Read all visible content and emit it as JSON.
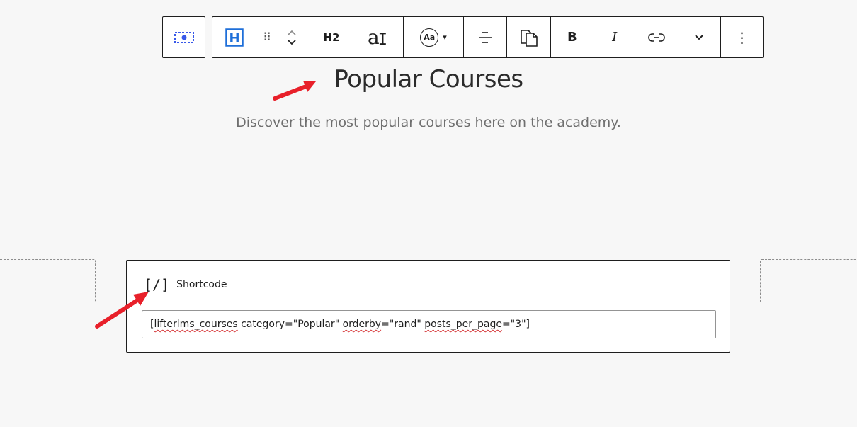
{
  "toolbar": {
    "parent_block_label": "Select parent block",
    "block_type_icon": "H",
    "drag_handle": "⠿",
    "heading_level": "H2",
    "font_size_icon": "a",
    "text_style_label": "Aa",
    "text_style_caret": "▾",
    "bold": "B",
    "italic": "I",
    "more_options": "⋮"
  },
  "heading": {
    "text": "Popular Courses"
  },
  "subtitle": {
    "text": "Discover the most popular courses here on the academy."
  },
  "shortcode_block": {
    "icon": "[/]",
    "label": "Shortcode",
    "value_parts": {
      "p1": "[",
      "p2": "lifterlms_courses",
      "p3": " category=\"Popular\" ",
      "p4": "orderby",
      "p5": "=\"rand\" ",
      "p6": "posts_per_page",
      "p7": "=\"3\"]"
    }
  },
  "colors": {
    "accent_blue": "#3858e9",
    "annotation_red": "#e8202a",
    "heading_block_blue": "#1e6fd9"
  }
}
